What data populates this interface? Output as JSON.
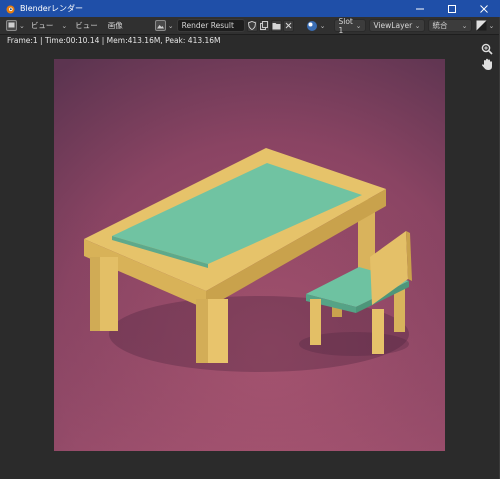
{
  "window": {
    "title": "Blenderレンダー",
    "title_color": "#1f4fa8",
    "controls": [
      "minimize-icon",
      "maximize-icon",
      "close-icon"
    ]
  },
  "header": {
    "menu_view": "ビュー",
    "view_label": "ビュー",
    "image_label": "画像",
    "image_name": "Render Result",
    "slot": "Slot 1",
    "view_layer": "ViewLayer",
    "pass": "統合"
  },
  "info": {
    "text": "Frame:1 | Time:00:10.14 | Mem:413.16M, Peak: 413.16M"
  },
  "tools": [
    "zoom-icon",
    "hand-pan-icon"
  ],
  "render": {
    "background_colors": [
      "#5e3850",
      "#a0506a"
    ],
    "table_top_color": "#e5c268",
    "table_mat_color": "#6cc2a0",
    "chair_seat_color": "#6cc2a0"
  }
}
